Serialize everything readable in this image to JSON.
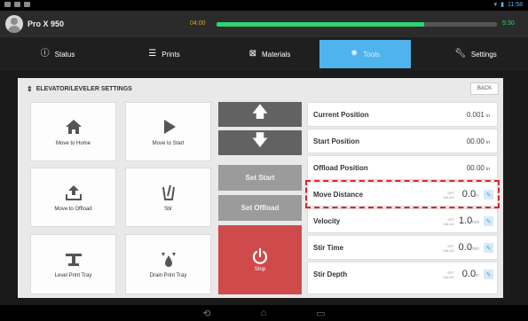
{
  "status_bar": {
    "time": "11:58"
  },
  "title_bar": {
    "device_name": "Pro X 950",
    "job_time_elapsed": "04:00",
    "job_time_total": "5:30",
    "progress_percent": 74
  },
  "tabs": [
    {
      "label": "Status",
      "icon": "info-icon"
    },
    {
      "label": "Prints",
      "icon": "list-icon"
    },
    {
      "label": "Materials",
      "icon": "materials-icon"
    },
    {
      "label": "Tools",
      "icon": "gear-icon",
      "active": true
    },
    {
      "label": "Settings",
      "icon": "wrench-icon"
    }
  ],
  "panel": {
    "title": "ELEVATOR/LEVELER SETTINGS",
    "back_label": "BACK",
    "buttons": {
      "move_home": "Move to Home",
      "move_start": "Move to Start",
      "move_offload": "Move to Offload",
      "stir": "Stir",
      "level_tray": "Level Print Tray",
      "drain_tray": "Drain Print Tray"
    },
    "set_start": "Set Start",
    "set_offload": "Set Offload",
    "stop": "Stop",
    "rows": {
      "current_position": {
        "label": "Current Position",
        "value": "0.001",
        "unit": "in"
      },
      "start_position": {
        "label": "Start Position",
        "value": "00.00",
        "unit": "in"
      },
      "offload_position": {
        "label": "Offload Position",
        "value": "00.00",
        "unit": "in"
      },
      "move_distance": {
        "label": "Move Distance",
        "set_label": "SET VALUE",
        "value": "0.0",
        "unit": "in"
      },
      "velocity": {
        "label": "Velocity",
        "set_label": "SET VALUE",
        "value": "1.0",
        "unit": "in/s"
      },
      "stir_time": {
        "label": "Stir Time",
        "set_label": "SET VALUE",
        "value": "0.0",
        "unit": "min"
      },
      "stir_depth": {
        "label": "Stir Depth",
        "set_label": "SET VALUE",
        "value": "0.0",
        "unit": "in"
      }
    }
  },
  "colors": {
    "accent": "#4fb3ec",
    "progress": "#2ed573",
    "stop": "#cf4a4a",
    "highlight": "#e0242c"
  }
}
